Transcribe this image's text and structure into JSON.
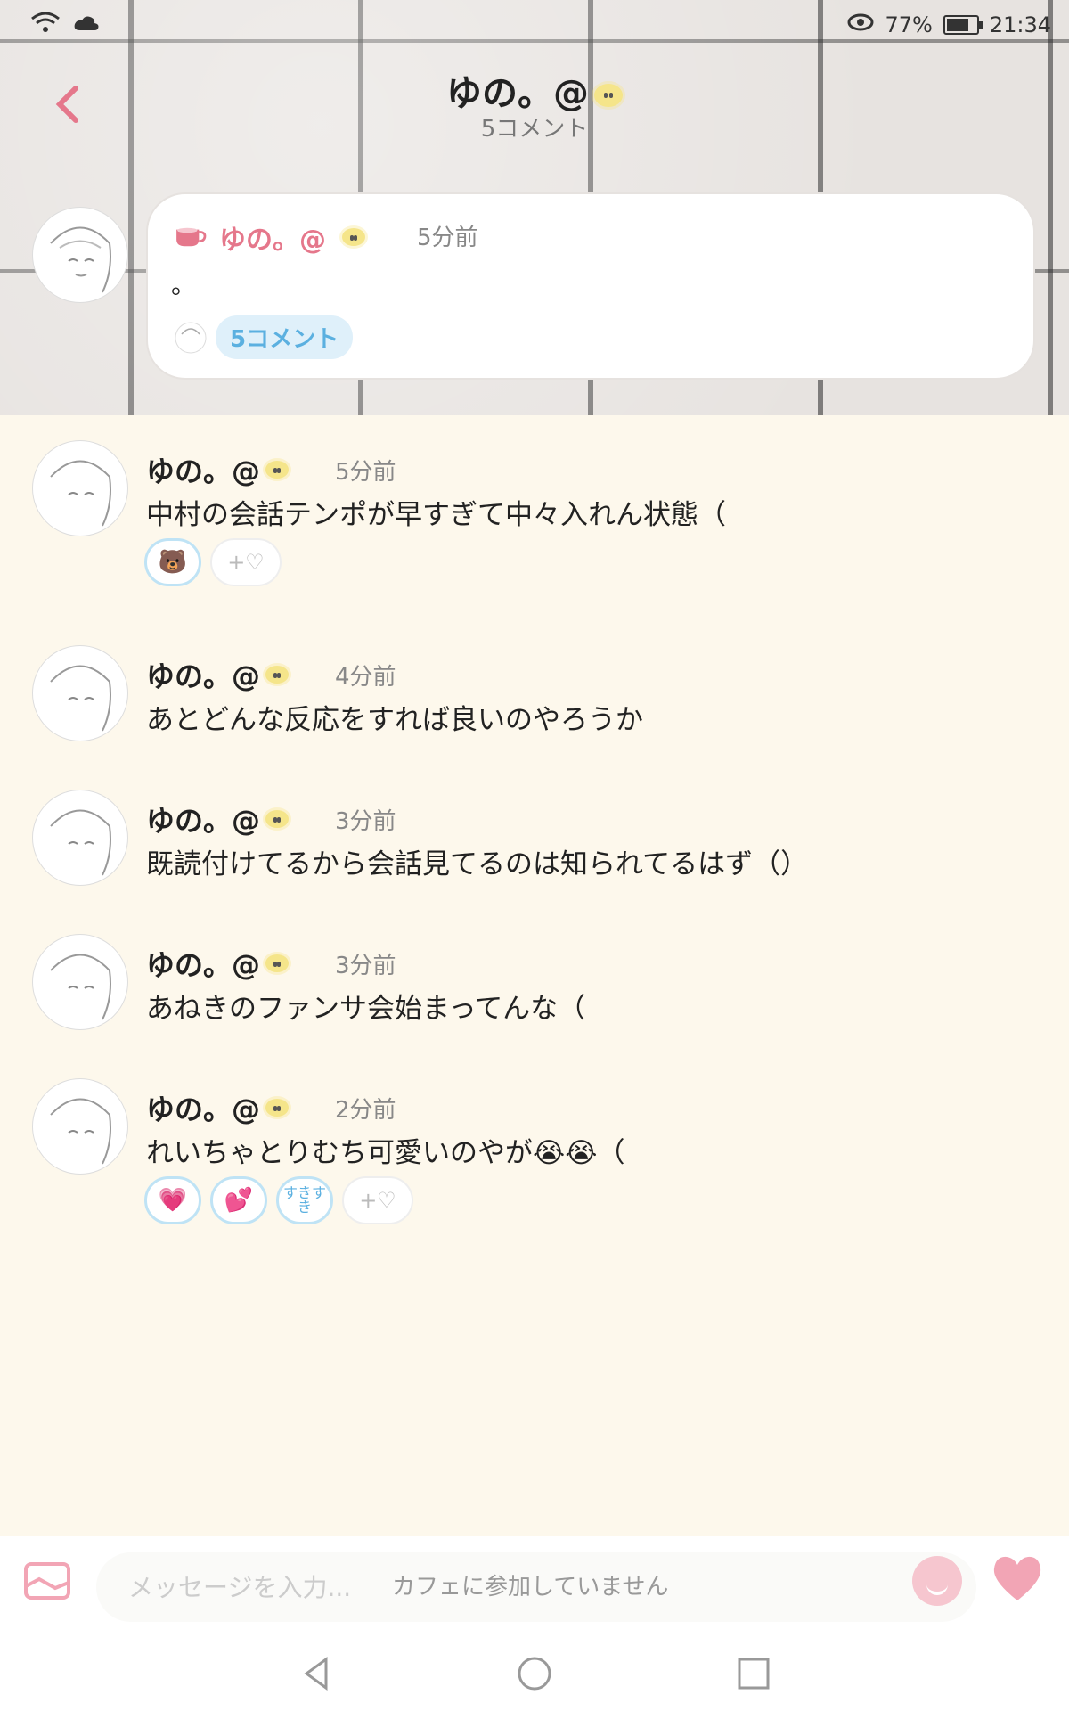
{
  "status_bar": {
    "battery": "77%",
    "time": "21:34"
  },
  "header": {
    "title": "ゆの。@",
    "subtitle": "5コメント"
  },
  "root_post": {
    "author": "ゆの。@",
    "time": "5分前",
    "text": "。",
    "comment_count_label": "5コメント"
  },
  "comments": [
    {
      "author": "ゆの。@",
      "time": "5分前",
      "text": "中村の会話テンポが早すぎて中々入れん状態（"
    },
    {
      "author": "ゆの。@",
      "time": "4分前",
      "text": "あとどんな反応をすれば良いのやろうか"
    },
    {
      "author": "ゆの。@",
      "time": "3分前",
      "text": "既読付けてるから会話見てるのは知られてるはず（）"
    },
    {
      "author": "ゆの。@",
      "time": "3分前",
      "text": "あねきのファンサ会始まってんな（"
    },
    {
      "author": "ゆの。@",
      "time": "2分前",
      "text": "れいちゃとりむち可愛いのやが😭😭（"
    }
  ],
  "reactions": {
    "comment0": [
      "🐻",
      "+♡"
    ],
    "comment4": [
      "💗",
      "💕",
      "すきすき",
      "+♡"
    ]
  },
  "input": {
    "placeholder": "メッセージを入力...",
    "notice": "カフェに参加していません"
  },
  "colors": {
    "accent": "#e5778b",
    "pill_text": "#5bb0e0",
    "background": "#fdf8ec"
  }
}
